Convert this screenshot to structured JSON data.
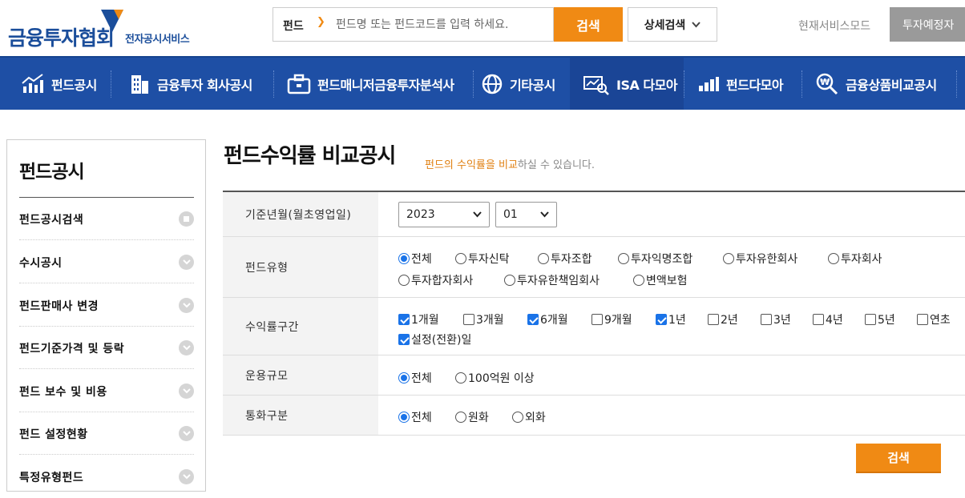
{
  "header": {
    "logo_main": "금융투자협회",
    "logo_sub": "전자공시서비스",
    "search_category": "펀드",
    "search_placeholder": "펀드명 또는 펀드코드를 입력 하세요.",
    "search_button": "검색",
    "detail_search": "상세검색",
    "service_mode": "현재서비스모드",
    "investor_button": "투자예정자"
  },
  "nav": {
    "items": [
      {
        "label": "펀드공시",
        "icon": "chart-up-icon"
      },
      {
        "label": "금융투자 회사공시",
        "icon": "building-icon"
      },
      {
        "label": "펀드매니저금융투자분석사",
        "icon": "briefcase-icon"
      },
      {
        "label": "기타공시",
        "icon": "globe-icon"
      },
      {
        "label": "ISA 다모아",
        "icon": "search-chart-icon"
      },
      {
        "label": "펀드다모아",
        "icon": "bar-chart-icon"
      },
      {
        "label": "금융상품비교공시",
        "icon": "magnifier-won-icon"
      }
    ]
  },
  "sidebar": {
    "title": "펀드공시",
    "items": [
      {
        "label": "펀드공시검색"
      },
      {
        "label": "수시공시"
      },
      {
        "label": "펀드판매사 변경"
      },
      {
        "label": "펀드기준가격 및 등락"
      },
      {
        "label": "펀드 보수 및 비용"
      },
      {
        "label": "펀드 설정현황"
      },
      {
        "label": "특정유형펀드"
      }
    ]
  },
  "main": {
    "title": "펀드수익률 비교공시",
    "desc_highlight": "펀드의 수익률을 비교",
    "desc_rest": "하실 수 있습니다.",
    "rows": {
      "base_month": {
        "label": "기준년월(월초영업일)",
        "year": "2023",
        "month": "01"
      },
      "fund_type": {
        "label": "펀드유형",
        "options": [
          "전체",
          "투자신탁",
          "투자조합",
          "투자익명조합",
          "투자유한회사",
          "투자회사",
          "투자합자회사",
          "투자유한책임회사",
          "변액보험"
        ],
        "selected": "전체"
      },
      "return_period": {
        "label": "수익률구간",
        "options": [
          {
            "label": "1개월",
            "checked": true
          },
          {
            "label": "3개월",
            "checked": false
          },
          {
            "label": "6개월",
            "checked": true
          },
          {
            "label": "9개월",
            "checked": false
          },
          {
            "label": "1년",
            "checked": true
          },
          {
            "label": "2년",
            "checked": false
          },
          {
            "label": "3년",
            "checked": false
          },
          {
            "label": "4년",
            "checked": false
          },
          {
            "label": "5년",
            "checked": false
          },
          {
            "label": "연초",
            "checked": false
          },
          {
            "label": "설정(전환)일",
            "checked": true
          }
        ]
      },
      "scale": {
        "label": "운용규모",
        "options": [
          "전체",
          "100억원 이상"
        ],
        "selected": "전체"
      },
      "currency": {
        "label": "통화구분",
        "options": [
          "전체",
          "원화",
          "외화"
        ],
        "selected": "전체"
      }
    },
    "search_button": "검색"
  },
  "colors": {
    "brand_blue": "#1e4fa5",
    "accent_orange": "#f08a14",
    "checked_blue": "#1a73e8"
  }
}
